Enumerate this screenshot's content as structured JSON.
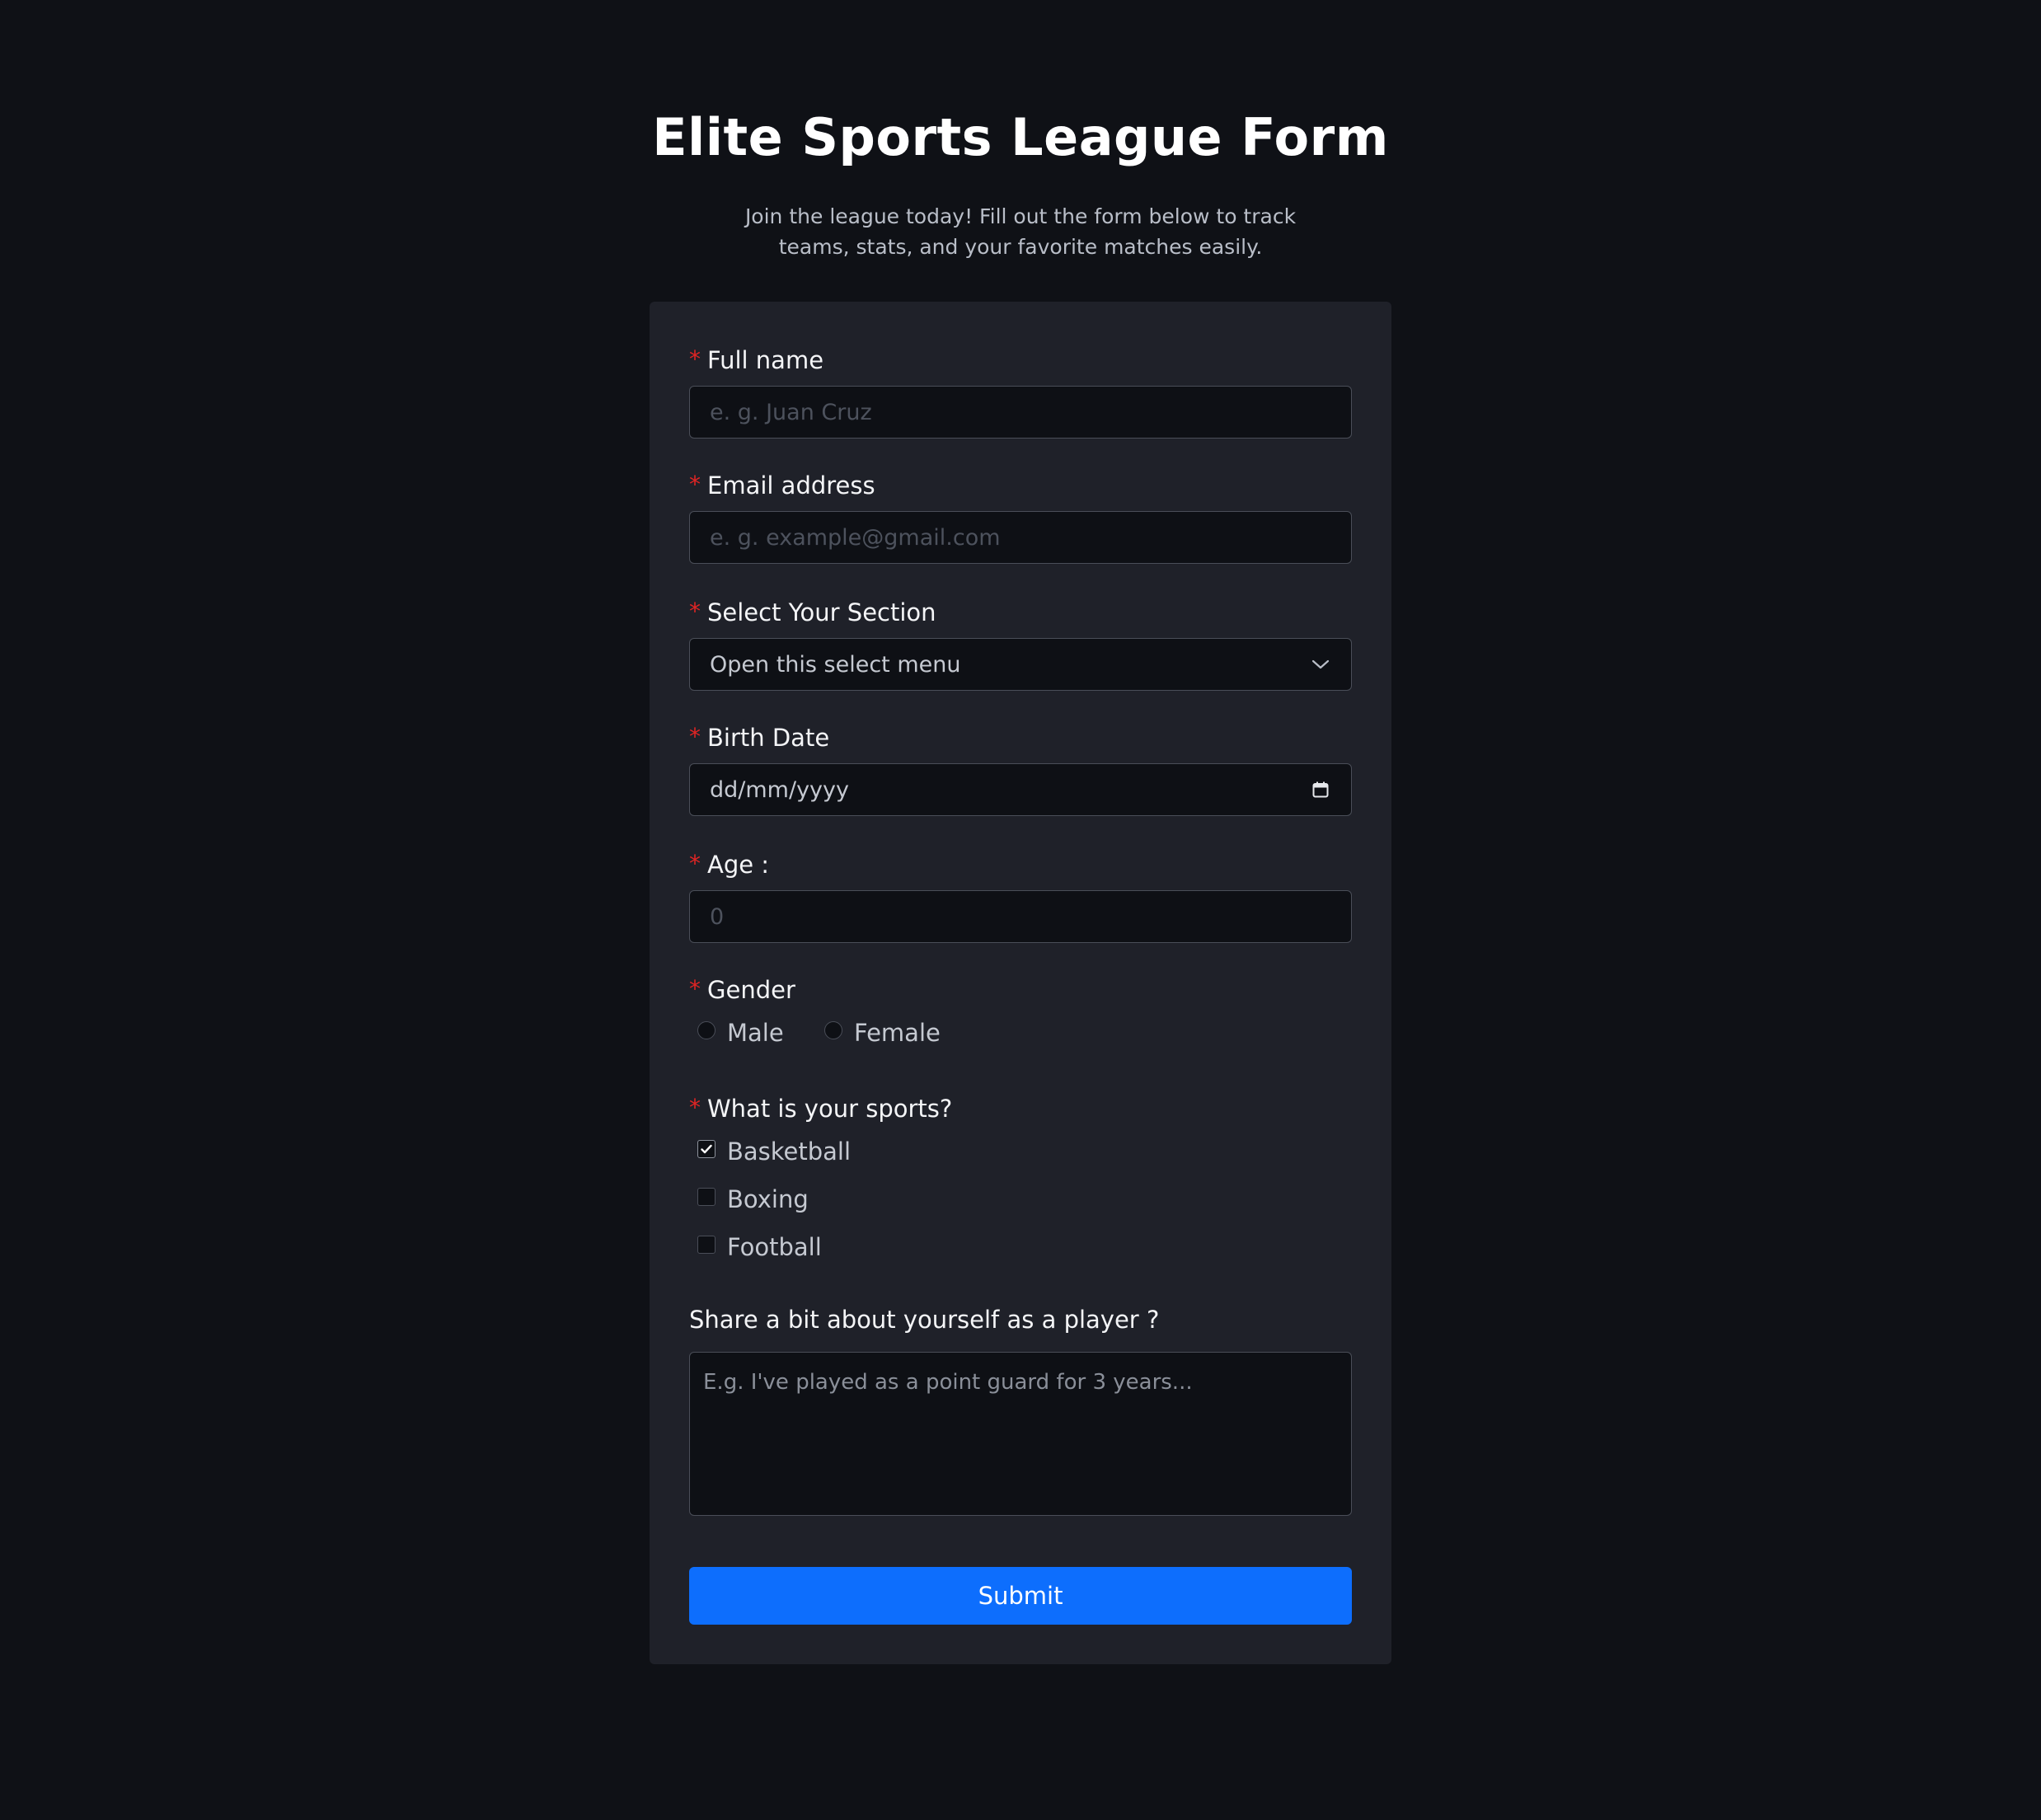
{
  "header": {
    "title": "Elite Sports League Form",
    "subtitle": "Join the league today! Fill out the form below to track teams, stats, and your favorite matches easily."
  },
  "form": {
    "required_marker": "*",
    "full_name": {
      "label": "Full name",
      "placeholder": "e. g. Juan Cruz",
      "value": ""
    },
    "email": {
      "label": "Email address",
      "placeholder": "e. g. example@gmail.com",
      "value": ""
    },
    "section": {
      "label": "Select Your Section",
      "selected": "Open this select menu",
      "icon": "chevron-down-icon"
    },
    "birth_date": {
      "label": "Birth Date",
      "value": "dd/mm/yyyy",
      "icon": "calendar-icon"
    },
    "age": {
      "label": "Age :",
      "placeholder": "0",
      "value": ""
    },
    "gender": {
      "label": "Gender",
      "options": [
        {
          "label": "Male",
          "selected": false
        },
        {
          "label": "Female",
          "selected": false
        }
      ]
    },
    "sports": {
      "label": "What is your sports?",
      "options": [
        {
          "label": "Basketball",
          "checked": true
        },
        {
          "label": "Boxing",
          "checked": false
        },
        {
          "label": "Football",
          "checked": false
        }
      ]
    },
    "about": {
      "label": "Share a bit about yourself as a player ?",
      "placeholder": "E.g. I've played as a point guard for 3 years...",
      "value": ""
    },
    "submit_label": "Submit"
  },
  "colors": {
    "background": "#0f1116",
    "card": "#1f2129",
    "input_bg": "#0e1015",
    "required": "#e02424",
    "primary": "#0d6efd"
  }
}
